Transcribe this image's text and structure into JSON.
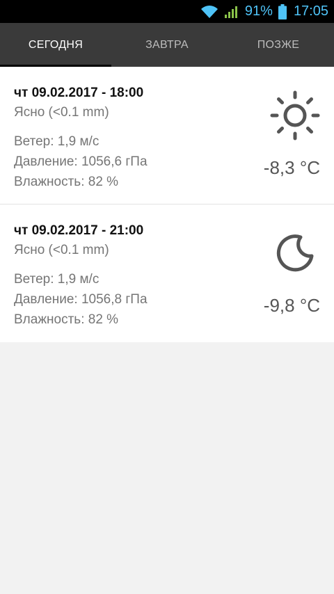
{
  "status_bar": {
    "battery_percent": "91%",
    "time": "17:05"
  },
  "tabs": [
    {
      "label": "СЕГОДНЯ",
      "active": true
    },
    {
      "label": "ЗАВТРА",
      "active": false
    },
    {
      "label": "ПОЗЖЕ",
      "active": false
    }
  ],
  "forecasts": [
    {
      "datetime": "чт 09.02.2017 - 18:00",
      "condition": "Ясно (<0.1 mm)",
      "wind": "Ветер: 1,9 м/с",
      "pressure": "Давление: 1056,6 гПа",
      "humidity": "Влажность: 82 %",
      "temperature": "-8,3 °C",
      "icon": "sun-icon"
    },
    {
      "datetime": "чт 09.02.2017 - 21:00",
      "condition": "Ясно (<0.1 mm)",
      "wind": "Ветер: 1,9 м/с",
      "pressure": "Давление: 1056,8 гПа",
      "humidity": "Влажность: 82 %",
      "temperature": "-9,8 °C",
      "icon": "moon-icon"
    }
  ],
  "colors": {
    "status_accent": "#4fc3f7",
    "tab_bar": "#3a3a3a",
    "signal": "#8bc34a"
  }
}
